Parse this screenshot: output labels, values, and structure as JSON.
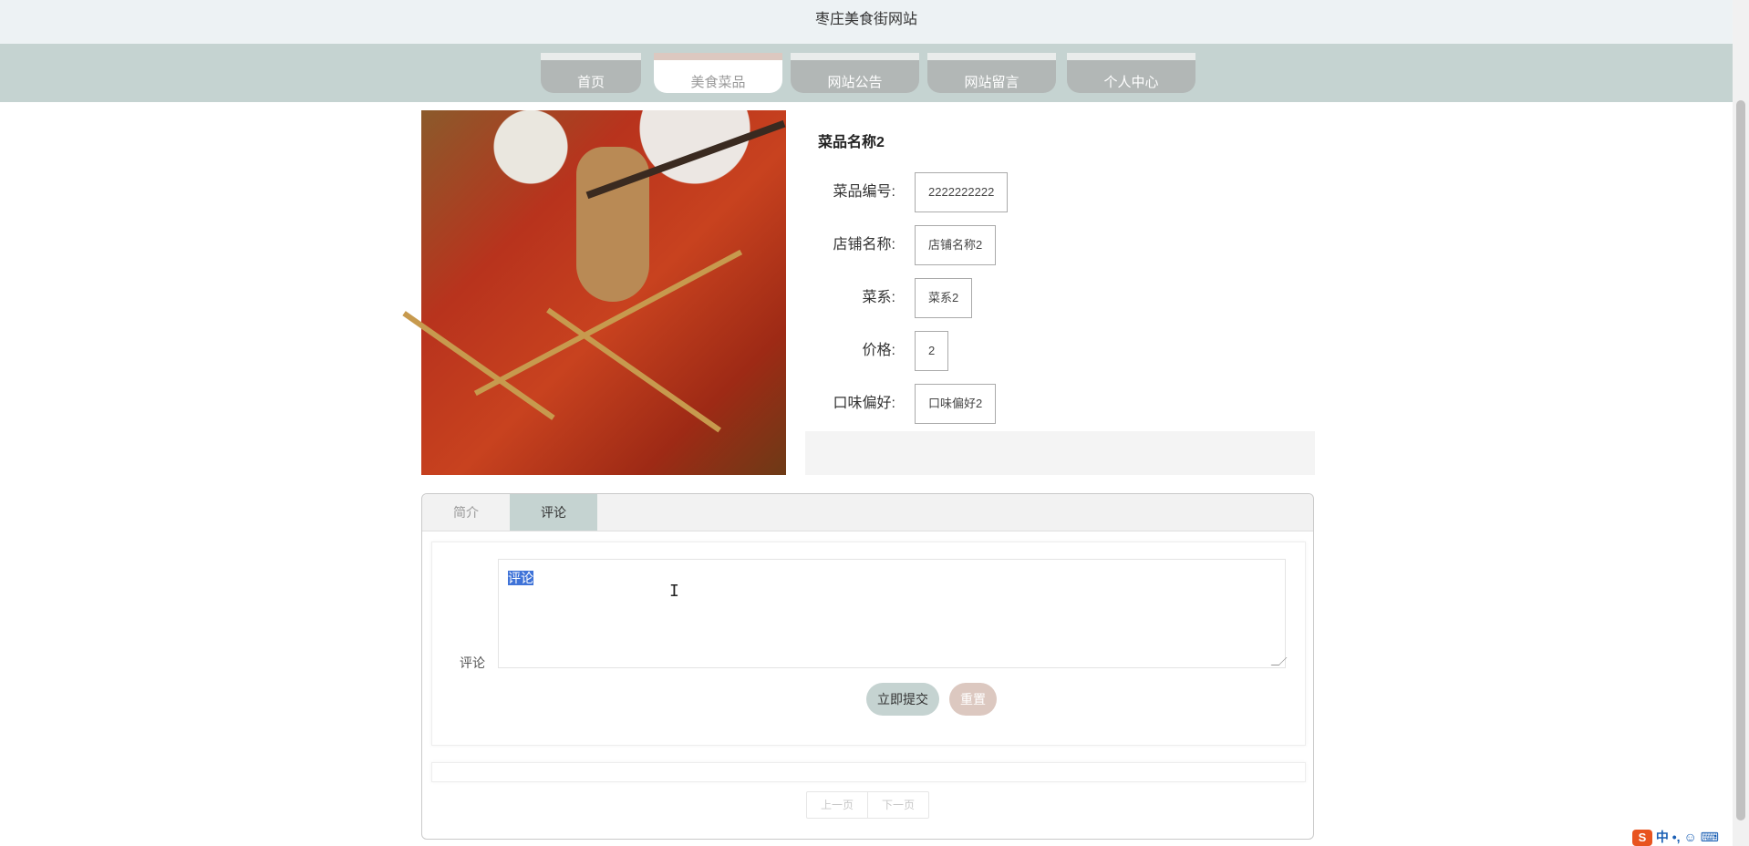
{
  "site": {
    "title": "枣庄美食街网站"
  },
  "nav": {
    "items": [
      {
        "label": "首页"
      },
      {
        "label": "美食菜品"
      },
      {
        "label": "网站公告"
      },
      {
        "label": "网站留言"
      },
      {
        "label": "个人中心"
      }
    ],
    "active_index": 1
  },
  "dish": {
    "name": "菜品名称2",
    "fields": [
      {
        "label": "菜品编号:",
        "value": "2222222222"
      },
      {
        "label": "店铺名称:",
        "value": "店铺名称2"
      },
      {
        "label": "菜系:",
        "value": "菜系2"
      },
      {
        "label": "价格:",
        "value": "2"
      },
      {
        "label": "口味偏好:",
        "value": "口味偏好2"
      }
    ]
  },
  "tabs": [
    {
      "label": "简介"
    },
    {
      "label": "评论"
    }
  ],
  "comment_form": {
    "label": "评论",
    "textarea_value": "评论",
    "submit_label": "立即提交",
    "reset_label": "重置"
  },
  "pager": {
    "prev_label": "上一页",
    "next_label": "下一页"
  },
  "ime": {
    "logo": "S",
    "text": "中 •, ☺ ⌨"
  },
  "colors": {
    "nav_bg": "#c5d3d1",
    "accent_pink": "#dcc8c0",
    "topbar_bg": "#edf2f4"
  }
}
